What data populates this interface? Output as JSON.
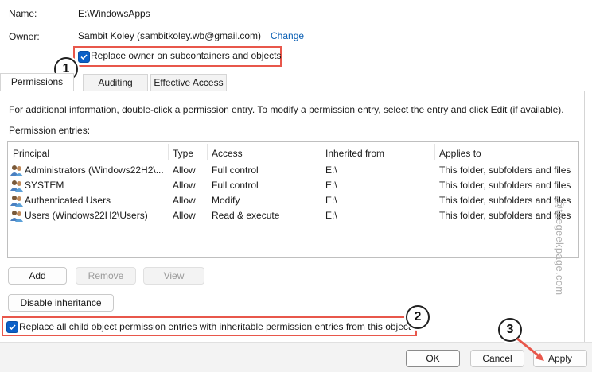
{
  "fields": {
    "name_label": "Name:",
    "name_value": "E:\\WindowsApps",
    "owner_label": "Owner:",
    "owner_value": "Sambit Koley (sambitkoley.wb@gmail.com)",
    "change_link": "Change"
  },
  "replace_owner": {
    "label": "Replace owner on subcontainers and objects",
    "checked": true
  },
  "tabs": [
    {
      "label": "Permissions",
      "active": true
    },
    {
      "label": "Auditing",
      "active": false
    },
    {
      "label": "Effective Access",
      "active": false
    }
  ],
  "info_text": "For additional information, double-click a permission entry. To modify a permission entry, select the entry and click Edit (if available).",
  "entries_label": "Permission entries:",
  "table": {
    "columns": [
      "Principal",
      "Type",
      "Access",
      "Inherited from",
      "Applies to"
    ],
    "rows": [
      {
        "principal": "Administrators (Windows22H2\\...",
        "type": "Allow",
        "access": "Full control",
        "inherited": "E:\\",
        "applies": "This folder, subfolders and files"
      },
      {
        "principal": "SYSTEM",
        "type": "Allow",
        "access": "Full control",
        "inherited": "E:\\",
        "applies": "This folder, subfolders and files"
      },
      {
        "principal": "Authenticated Users",
        "type": "Allow",
        "access": "Modify",
        "inherited": "E:\\",
        "applies": "This folder, subfolders and files"
      },
      {
        "principal": "Users (Windows22H2\\Users)",
        "type": "Allow",
        "access": "Read & execute",
        "inherited": "E:\\",
        "applies": "This folder, subfolders and files"
      }
    ]
  },
  "buttons": {
    "add": "Add",
    "remove": "Remove",
    "view": "View",
    "disable_inheritance": "Disable inheritance",
    "ok": "OK",
    "cancel": "Cancel",
    "apply": "Apply"
  },
  "replace_child": {
    "label": "Replace all child object permission entries with inheritable permission entries from this object",
    "checked": true
  },
  "steps": [
    "1",
    "2",
    "3"
  ],
  "watermark": "@thegeekpage.com",
  "colors": {
    "accent": "#0b5fc7",
    "highlight": "#e8574b",
    "link": "#0a5fb4"
  }
}
